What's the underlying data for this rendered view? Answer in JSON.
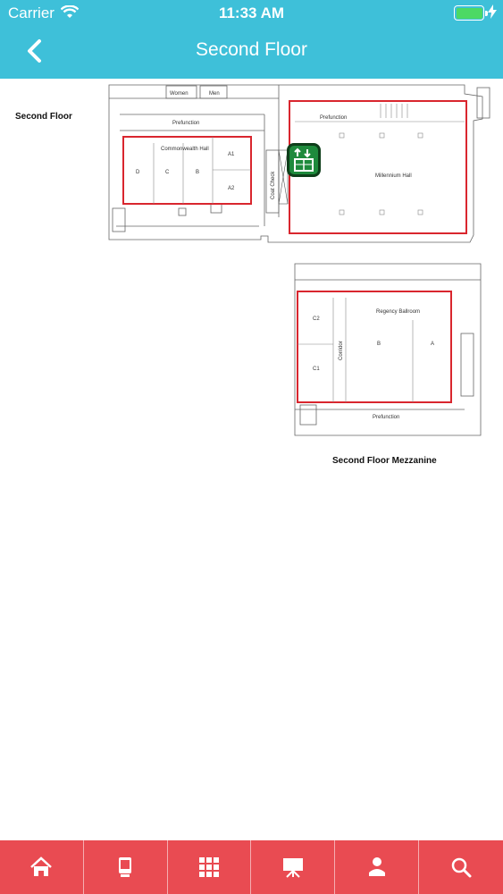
{
  "status_bar": {
    "carrier": "Carrier",
    "time": "11:33 AM",
    "battery_level": 1.0
  },
  "header": {
    "title": "Second Floor",
    "back_icon": "chevron-left-icon"
  },
  "map": {
    "floor_label": "Second Floor",
    "mezzanine_label": "Second Floor Mezzanine",
    "rooms": {
      "women": "Women",
      "men": "Men",
      "prefunction_left": "Prefunction",
      "commonwealth_hall": "Commonwealth Hall",
      "d": "D",
      "c": "C",
      "b": "B",
      "a1": "A1",
      "a2": "A2",
      "coat_check": "Coat Check",
      "prefunction_right": "Prefunction",
      "millennium_hall": "Millennium Hall",
      "regency_ballroom": "Regency Ballroom",
      "c2": "C2",
      "c1": "C1",
      "corridor": "Corridor",
      "rb_b": "B",
      "rb_a": "A",
      "prefunction_bottom": "Prefunction"
    },
    "elevator_icon": "elevator-icon"
  },
  "tabbar": {
    "items": [
      {
        "name": "home",
        "icon": "home-icon"
      },
      {
        "name": "kiosk",
        "icon": "kiosk-icon"
      },
      {
        "name": "grid",
        "icon": "grid-icon"
      },
      {
        "name": "presentation",
        "icon": "presentation-icon"
      },
      {
        "name": "speaker",
        "icon": "speaker-icon"
      },
      {
        "name": "search",
        "icon": "search-icon"
      }
    ]
  },
  "colors": {
    "header": "#3ec0d9",
    "tabbar": "#e94b52",
    "highlight": "#d9262e",
    "elevator": "#1e8a3c"
  }
}
